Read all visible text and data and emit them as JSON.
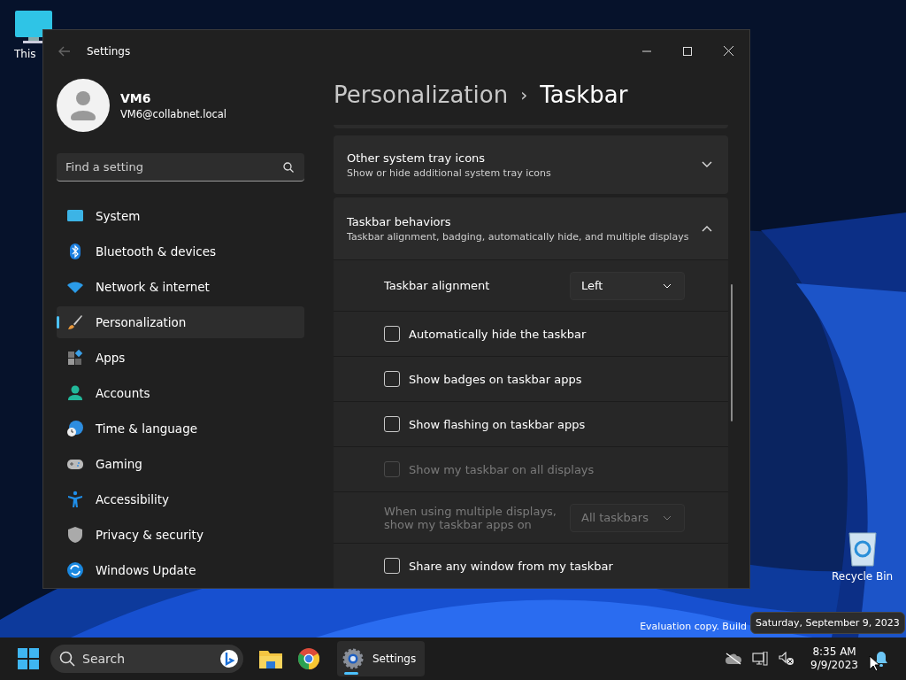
{
  "desktop_icons": [
    {
      "label": "This"
    },
    {
      "label": "Recycle Bin"
    }
  ],
  "window": {
    "title": "Settings"
  },
  "profile": {
    "name": "VM6",
    "email": "VM6@collabnet.local"
  },
  "search": {
    "placeholder": "Find a setting"
  },
  "sidebar": {
    "items": [
      {
        "label": "System",
        "selected": false
      },
      {
        "label": "Bluetooth & devices",
        "selected": false
      },
      {
        "label": "Network & internet",
        "selected": false
      },
      {
        "label": "Personalization",
        "selected": true
      },
      {
        "label": "Apps",
        "selected": false
      },
      {
        "label": "Accounts",
        "selected": false
      },
      {
        "label": "Time & language",
        "selected": false
      },
      {
        "label": "Gaming",
        "selected": false
      },
      {
        "label": "Accessibility",
        "selected": false
      },
      {
        "label": "Privacy & security",
        "selected": false
      },
      {
        "label": "Windows Update",
        "selected": false
      }
    ]
  },
  "breadcrumb": {
    "parent": "Personalization",
    "separator": "›",
    "current": "Taskbar"
  },
  "settings": [
    {
      "kind": "expander",
      "title": "Other system tray icons",
      "subtitle": "Show or hide additional system tray icons",
      "expanded": false
    },
    {
      "kind": "expander",
      "title": "Taskbar behaviors",
      "subtitle": "Taskbar alignment, badging, automatically hide, and multiple displays",
      "expanded": true
    },
    {
      "kind": "dropdown",
      "label": "Taskbar alignment",
      "value": "Left",
      "disabled": false
    },
    {
      "kind": "checkbox",
      "label": "Automatically hide the taskbar",
      "checked": false,
      "disabled": false
    },
    {
      "kind": "checkbox",
      "label": "Show badges on taskbar apps",
      "checked": false,
      "disabled": false
    },
    {
      "kind": "checkbox",
      "label": "Show flashing on taskbar apps",
      "checked": false,
      "disabled": false
    },
    {
      "kind": "checkbox",
      "label": "Show my taskbar on all displays",
      "checked": false,
      "disabled": true
    },
    {
      "kind": "dropdown",
      "label": "When using multiple displays, show my taskbar apps on",
      "value": "All taskbars",
      "disabled": true
    },
    {
      "kind": "checkbox",
      "label": "Share any window from my taskbar",
      "checked": false,
      "disabled": false
    }
  ],
  "watermark_text": "Evaluation copy. Build",
  "tooltip": "Saturday, September 9, 2023",
  "taskbar": {
    "search_placeholder": "Search",
    "apps": [
      {
        "label": "Settings",
        "selected": true
      }
    ],
    "time": "8:35 AM",
    "date": "9/9/2023"
  }
}
